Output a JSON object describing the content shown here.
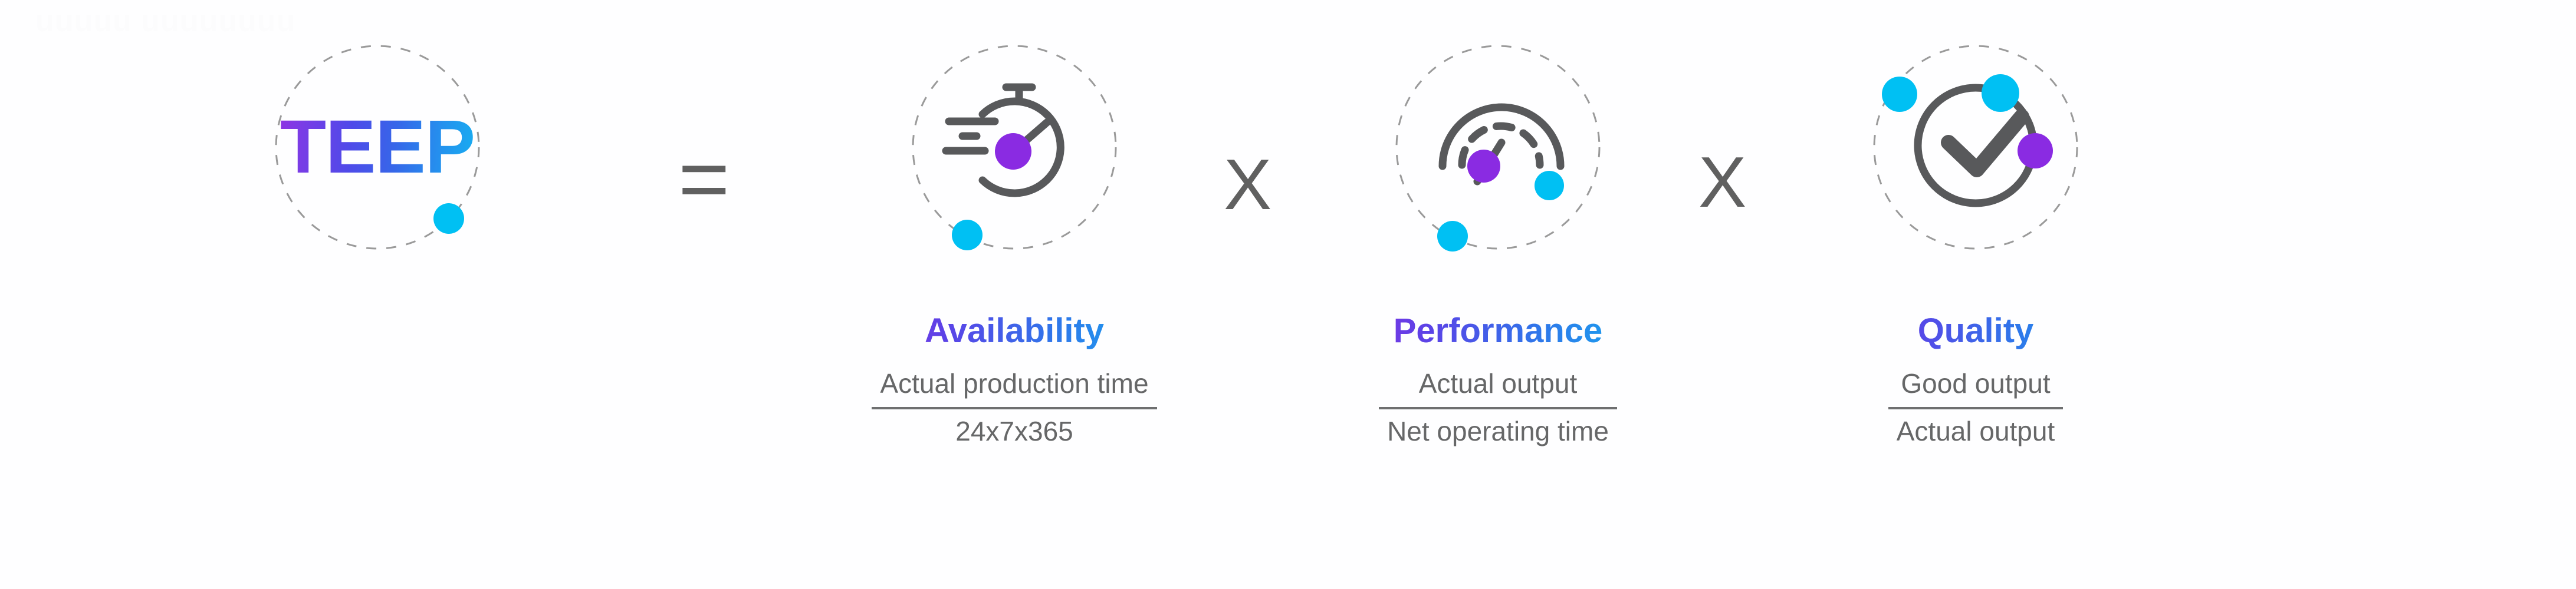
{
  "watermark": {
    "text": "uuuuu uuuuuuuu"
  },
  "formula": {
    "result": {
      "wordmark": "TEEP",
      "icon": "teep-wordmark"
    },
    "equals_operator": "=",
    "multiply_operator": "X",
    "terms": [
      {
        "title": "Availability",
        "icon": "stopwatch-icon",
        "numerator": "Actual production time",
        "denominator": "24x7x365"
      },
      {
        "title": "Performance",
        "icon": "gauge-icon",
        "numerator": "Actual output",
        "denominator": "Net operating time"
      },
      {
        "title": "Quality",
        "icon": "check-circle-icon",
        "numerator": "Good output",
        "denominator": "Actual output"
      }
    ]
  },
  "colors": {
    "gradient_start": "#9b2fe0",
    "gradient_mid": "#3667e9",
    "gradient_end": "#12b9f2",
    "accent_cyan": "#00c0f3",
    "accent_purple": "#8a2be2",
    "line_gray": "#58595b",
    "dash_gray": "#9a9a9a",
    "text_gray": "#666768",
    "background": "#fefeff"
  }
}
